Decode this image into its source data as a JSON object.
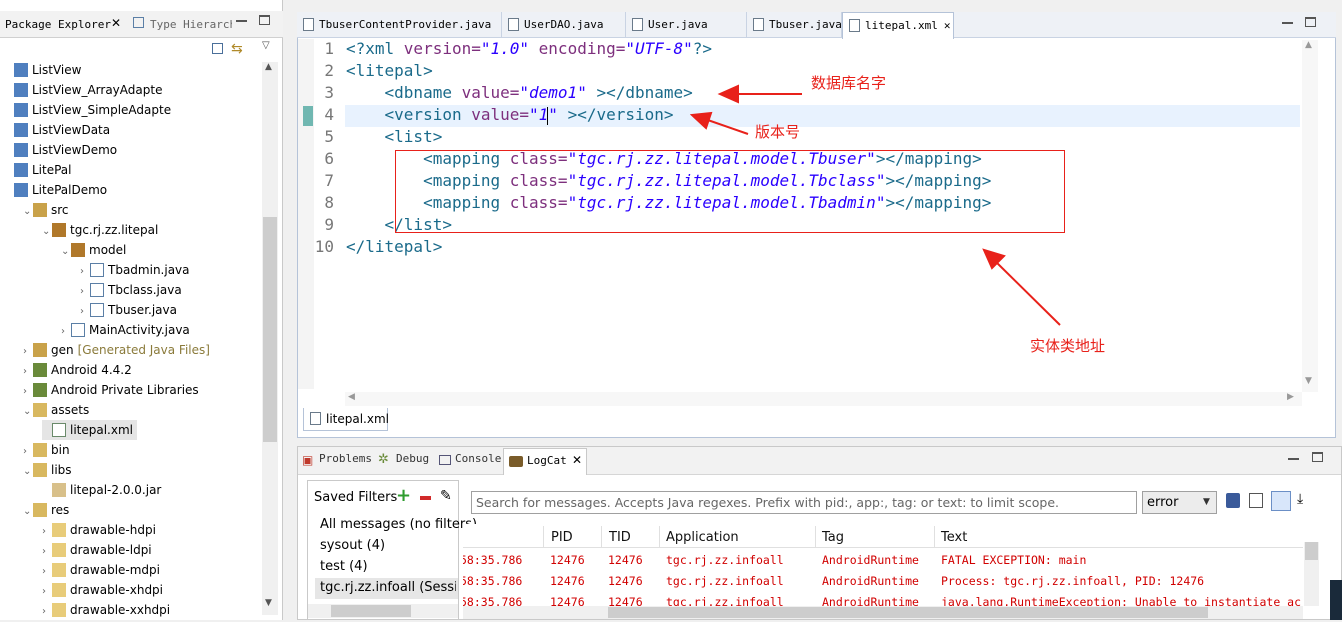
{
  "package_explorer": {
    "tab_label": "Package Explorer",
    "tab2_label": "Type Hierarchy",
    "items": [
      {
        "label": "ListView",
        "level": 0
      },
      {
        "label": "ListView_ArrayAdapte",
        "level": 0
      },
      {
        "label": "ListView_SimpleAdapte",
        "level": 0
      },
      {
        "label": "ListViewData",
        "level": 0
      },
      {
        "label": "ListViewDemo",
        "level": 0
      },
      {
        "label": "LitePal",
        "level": 0
      },
      {
        "label": "LitePalDemo",
        "level": 0
      },
      {
        "label": "src",
        "level": 1
      },
      {
        "label": "tgc.rj.zz.litepal",
        "level": 2
      },
      {
        "label": "model",
        "level": 3
      },
      {
        "label": "Tbadmin.java",
        "level": 4
      },
      {
        "label": "Tbclass.java",
        "level": 4
      },
      {
        "label": "Tbuser.java",
        "level": 4
      },
      {
        "label": "MainActivity.java",
        "level": 3
      },
      {
        "label": "gen",
        "extra": "[Generated Java Files]",
        "level": 1
      },
      {
        "label": "Android 4.4.2",
        "level": 1
      },
      {
        "label": "Android Private Libraries",
        "level": 1
      },
      {
        "label": "assets",
        "level": 1
      },
      {
        "label": "litepal.xml",
        "level": 2
      },
      {
        "label": "bin",
        "level": 1
      },
      {
        "label": "libs",
        "level": 1
      },
      {
        "label": "litepal-2.0.0.jar",
        "level": 2
      },
      {
        "label": "res",
        "level": 1
      },
      {
        "label": "drawable-hdpi",
        "level": 2
      },
      {
        "label": "drawable-ldpi",
        "level": 2
      },
      {
        "label": "drawable-mdpi",
        "level": 2
      },
      {
        "label": "drawable-xhdpi",
        "level": 2
      },
      {
        "label": "drawable-xxhdpi",
        "level": 2
      }
    ]
  },
  "editor": {
    "tabs": [
      "TbuserContentProvider.java",
      "UserDAO.java",
      "User.java",
      "Tbuser.java",
      "litepal.xml"
    ],
    "bottom_tab": "litepal.xml",
    "lines": {
      "l1": {
        "n": "1",
        "a": "<?xml ",
        "b": "version=",
        "c": "\"1.0\"",
        "d": " encoding=",
        "e": "\"UTF-8\"",
        "f": "?>"
      },
      "l2": {
        "n": "2",
        "t": "<litepal>"
      },
      "l3": {
        "n": "3",
        "a": "    <dbname ",
        "b": "value=",
        "c": "\"demo1\"",
        "d": " ></dbname>"
      },
      "l4": {
        "n": "4",
        "a": "    <version ",
        "b": "value=",
        "c": "\"1\"",
        "d": " ></version>"
      },
      "l5": {
        "n": "5",
        "t": "    <list>"
      },
      "l6": {
        "n": "6",
        "a": "        <mapping ",
        "b": "class=",
        "c": "\"tgc.rj.zz.litepal.model.Tbuser\"",
        "d": "></mapping>"
      },
      "l7": {
        "n": "7",
        "a": "        <mapping ",
        "b": "class=",
        "c": "\"tgc.rj.zz.litepal.model.Tbclass\"",
        "d": "></mapping>"
      },
      "l8": {
        "n": "8",
        "a": "        <mapping ",
        "b": "class=",
        "c": "\"tgc.rj.zz.litepal.model.Tbadmin\"",
        "d": "></mapping>"
      },
      "l9": {
        "n": "9",
        "t": "    </list>"
      },
      "l10": {
        "n": "10",
        "t": "</litepal>"
      }
    },
    "annotations": {
      "dbname": "数据库名字",
      "version": "版本号",
      "entity": "实体类地址"
    }
  },
  "logcat": {
    "tabs": [
      "Problems",
      "Debug",
      "Console",
      "LogCat"
    ],
    "saved_filters": "Saved Filters",
    "filters": [
      "All messages (no filters)",
      "sysout (4)",
      "test (4)",
      "tgc.rj.zz.infoall (Session"
    ],
    "search_placeholder": "Search for messages. Accepts Java regexes. Prefix with pid:, app:, tag: or text: to limit scope.",
    "level": "error",
    "columns": [
      "PID",
      "TID",
      "Application",
      "Tag",
      "Text"
    ],
    "rows": [
      {
        "time": "58:35.786",
        "pid": "12476",
        "tid": "12476",
        "app": "tgc.rj.zz.infoall",
        "tag": "AndroidRuntime",
        "text": "FATAL EXCEPTION: main"
      },
      {
        "time": "58:35.786",
        "pid": "12476",
        "tid": "12476",
        "app": "tgc.rj.zz.infoall",
        "tag": "AndroidRuntime",
        "text": "Process: tgc.rj.zz.infoall, PID: 12476"
      },
      {
        "time": "58:35.786",
        "pid": "12476",
        "tid": "12476",
        "app": "tgc.rj.zz.infoall",
        "tag": "AndroidRuntime",
        "text": "java.lang.RuntimeException: Unable to instantiate ac"
      }
    ]
  },
  "colors": {
    "annotation": "#e8211a",
    "log_error": "#d10000",
    "tag": "#1a6a8a",
    "attr": "#7d2f7d",
    "value": "#2a00ff"
  }
}
